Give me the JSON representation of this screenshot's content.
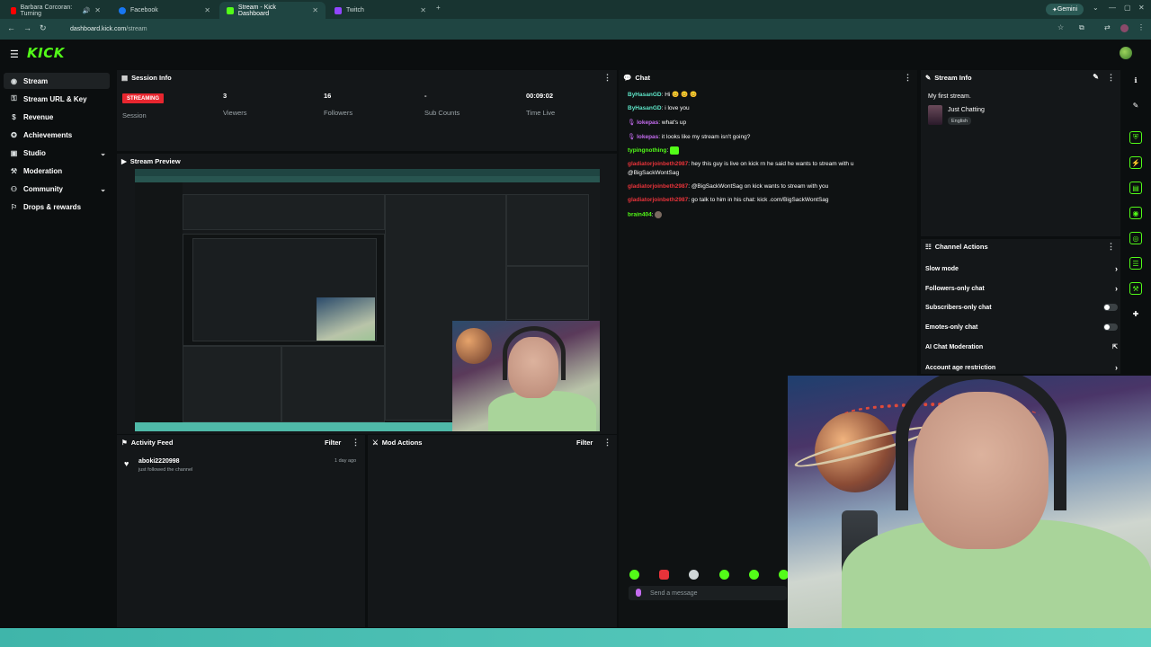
{
  "browser": {
    "tabs": [
      {
        "title": "Barbara Corcoran: Turning",
        "active": false,
        "icon": "youtube-icon",
        "color": "#ff0000"
      },
      {
        "title": "Facebook",
        "active": false,
        "icon": "facebook-icon",
        "color": "#1877f2"
      },
      {
        "title": "Stream - Kick Dashboard",
        "active": true,
        "icon": "kick-icon",
        "color": "#53fc18"
      },
      {
        "title": "Twitch",
        "active": false,
        "icon": "twitch-icon",
        "color": "#9146ff"
      }
    ],
    "url_host": "dashboard.kick.com",
    "url_path": "/stream",
    "gemini_label": "Gemini"
  },
  "brand": {
    "logo": "KICK",
    "accent": "#53fc18"
  },
  "sidebar": {
    "items": [
      {
        "label": "Stream",
        "icon": "signal-icon",
        "active": true,
        "expandable": false
      },
      {
        "label": "Stream URL & Key",
        "icon": "key-icon",
        "active": false,
        "expandable": false
      },
      {
        "label": "Revenue",
        "icon": "dollar-icon",
        "active": false,
        "expandable": false
      },
      {
        "label": "Achievements",
        "icon": "trophy-icon",
        "active": false,
        "expandable": false
      },
      {
        "label": "Studio",
        "icon": "folder-icon",
        "active": false,
        "expandable": true
      },
      {
        "label": "Moderation",
        "icon": "hammer-icon",
        "active": false,
        "expandable": false
      },
      {
        "label": "Community",
        "icon": "users-icon",
        "active": false,
        "expandable": true
      },
      {
        "label": "Drops & rewards",
        "icon": "gift-icon",
        "active": false,
        "expandable": false
      }
    ]
  },
  "session": {
    "title": "Session Info",
    "badge": "STREAMING",
    "session_label": "Session",
    "viewers": "3",
    "viewers_label": "Viewers",
    "followers": "16",
    "followers_label": "Followers",
    "subs": "-",
    "subs_label": "Sub Counts",
    "time": "00:09:02",
    "time_label": "Time Live"
  },
  "preview": {
    "title": "Stream Preview"
  },
  "activity": {
    "title": "Activity Feed",
    "filter": "Filter",
    "items": [
      {
        "user": "aboki2220998",
        "action": "just followed the channel",
        "time": "1 day ago"
      }
    ]
  },
  "mod_actions": {
    "title": "Mod Actions",
    "filter": "Filter"
  },
  "chat": {
    "title": "Chat",
    "messages": [
      {
        "user": "ByHasanGD",
        "color": "#5ee6c8",
        "text": "Hi 😊 😊 😊"
      },
      {
        "user": "ByHasanGD",
        "color": "#5ee6c8",
        "text": "i love you"
      },
      {
        "user": "lokepas",
        "color": "#c56cf0",
        "text": "what's up"
      },
      {
        "user": "lokepas",
        "color": "#c56cf0",
        "text": "it looks like my stream isn't going?"
      },
      {
        "user": "typingnothing",
        "color": "#53fc18",
        "text": ""
      },
      {
        "user": "gladiatorjoinbeth2987",
        "color": "#e8333a",
        "text": "hey this guy is live on kick rn he said he wants to stream with u"
      },
      {
        "user": "",
        "color": "#ffffff",
        "text": "@BigSackWontSag"
      },
      {
        "user": "gladiatorjoinbeth2987",
        "color": "#e8333a",
        "text": "@BigSackWontSag on kick wants to stream with you"
      },
      {
        "user": "gladiatorjoinbeth2987",
        "color": "#e8333a",
        "text": "go talk to him in his chat: kick .com/BigSackWontSag"
      },
      {
        "user": "brain404",
        "color": "#53fc18",
        "text": ""
      }
    ],
    "input_placeholder": "Send a message"
  },
  "stream_info": {
    "title": "Stream Info",
    "stream_title": "My first stream.",
    "category": "Just Chatting",
    "language": "English"
  },
  "channel_actions": {
    "title": "Channel Actions",
    "rows": [
      {
        "label": "Slow mode",
        "control": "chevron"
      },
      {
        "label": "Followers-only chat",
        "control": "chevron"
      },
      {
        "label": "Subscribers-only chat",
        "control": "toggle"
      },
      {
        "label": "Emotes-only chat",
        "control": "toggle"
      },
      {
        "label": "AI Chat Moderation",
        "control": "external"
      },
      {
        "label": "Account age restriction",
        "control": "chevron"
      }
    ]
  }
}
